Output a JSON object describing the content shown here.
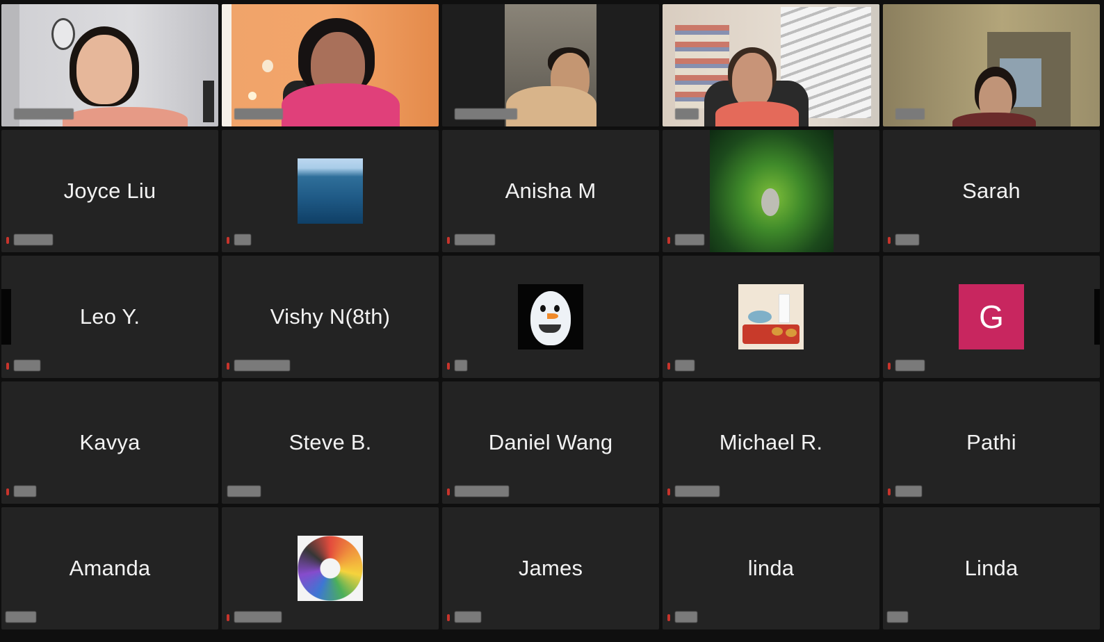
{
  "participants": {
    "row2": [
      "Joyce Liu",
      "",
      "Anisha M",
      "",
      "Sarah"
    ],
    "row3": [
      "Leo Y.",
      "Vishy N(8th)",
      "",
      "",
      ""
    ],
    "row4": [
      "Kavya",
      "Steve B.",
      "Daniel Wang",
      "Michael R.",
      "Pathi"
    ],
    "row5": [
      "Amanda",
      "",
      "James",
      "linda",
      "Linda"
    ]
  },
  "avatars": {
    "g_letter": "G"
  },
  "colors": {
    "tile_bg": "#232323",
    "active_speaker": "#3fbf3f",
    "muted_mic": "#c8342c",
    "g_avatar": "#c8265f"
  },
  "icons": {
    "mic": "muted-mic-icon",
    "ocean": "ocean-avatar",
    "forest": "forest-avatar",
    "snowman": "snowman-avatar",
    "food": "food-avatar",
    "pencils": "colored-pencils-avatar"
  }
}
